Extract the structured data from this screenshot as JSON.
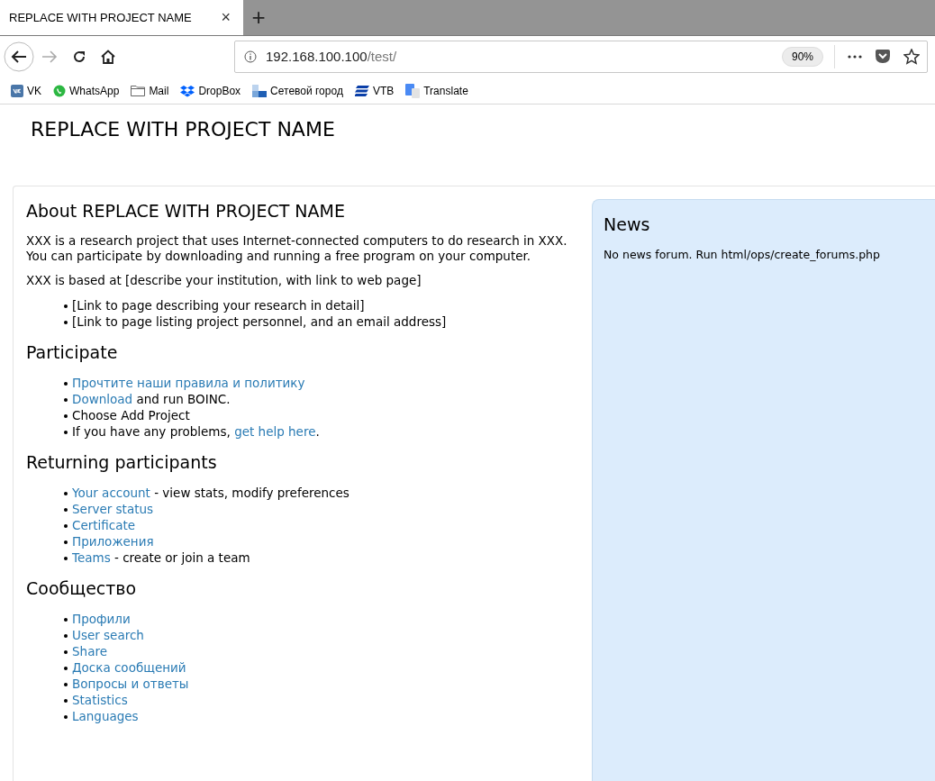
{
  "browser": {
    "tab": {
      "title": "REPLACE WITH PROJECT NAME",
      "close": "×",
      "selected": true
    },
    "new_tab": "+",
    "address": {
      "host": "192.168.100.100",
      "path": "/test/"
    },
    "zoom": "90%",
    "bookmarks": [
      {
        "label": "VK",
        "kind": "vk"
      },
      {
        "label": "WhatsApp",
        "kind": "whatsapp"
      },
      {
        "label": "Mail",
        "kind": "folder"
      },
      {
        "label": "DropBox",
        "kind": "dropbox"
      },
      {
        "label": "Сетевой город",
        "kind": "squares"
      },
      {
        "label": "VTB",
        "kind": "vtb"
      },
      {
        "label": "Translate",
        "kind": "translate"
      }
    ]
  },
  "page": {
    "title": "REPLACE WITH PROJECT NAME",
    "about": {
      "heading": "About REPLACE WITH PROJECT NAME",
      "paragraphs": [
        "XXX is a research project that uses Internet-connected computers to do research in XXX. You can participate by downloading and running a free program on your computer.",
        "XXX is based at [describe your institution, with link to web page]"
      ],
      "items": [
        [
          {
            "kind": "text",
            "text": "[Link to page describing your research in detail]"
          }
        ],
        [
          {
            "kind": "text",
            "text": "[Link to page listing project personnel, and an email address]"
          }
        ]
      ]
    },
    "sections": [
      {
        "heading": "Participate",
        "items": [
          [
            {
              "kind": "link",
              "text": "Прочтите наши правила и политику"
            }
          ],
          [
            {
              "kind": "link",
              "text": "Download"
            },
            {
              "kind": "text",
              "text": " and run BOINC."
            }
          ],
          [
            {
              "kind": "text",
              "text": "Choose Add Project"
            }
          ],
          [
            {
              "kind": "text",
              "text": "If you have any problems, "
            },
            {
              "kind": "link",
              "text": "get help here"
            },
            {
              "kind": "text",
              "text": "."
            }
          ]
        ]
      },
      {
        "heading": "Returning participants",
        "items": [
          [
            {
              "kind": "link",
              "text": "Your account"
            },
            {
              "kind": "text",
              "text": " - view stats, modify preferences"
            }
          ],
          [
            {
              "kind": "link",
              "text": "Server status"
            }
          ],
          [
            {
              "kind": "link",
              "text": "Certificate"
            }
          ],
          [
            {
              "kind": "link",
              "text": "Приложения"
            }
          ],
          [
            {
              "kind": "link",
              "text": "Teams"
            },
            {
              "kind": "text",
              "text": " - create or join a team"
            }
          ]
        ]
      },
      {
        "heading": "Сообщество",
        "items": [
          [
            {
              "kind": "link",
              "text": "Профили"
            }
          ],
          [
            {
              "kind": "link",
              "text": "User search"
            }
          ],
          [
            {
              "kind": "link",
              "text": "Share"
            }
          ],
          [
            {
              "kind": "link",
              "text": "Доска сообщений"
            }
          ],
          [
            {
              "kind": "link",
              "text": "Вопросы и ответы"
            }
          ],
          [
            {
              "kind": "link",
              "text": "Statistics"
            }
          ],
          [
            {
              "kind": "link",
              "text": "Languages"
            }
          ]
        ]
      }
    ],
    "news": {
      "heading": "News",
      "text": "No news forum. Run html/ops/create_forums.php"
    }
  }
}
